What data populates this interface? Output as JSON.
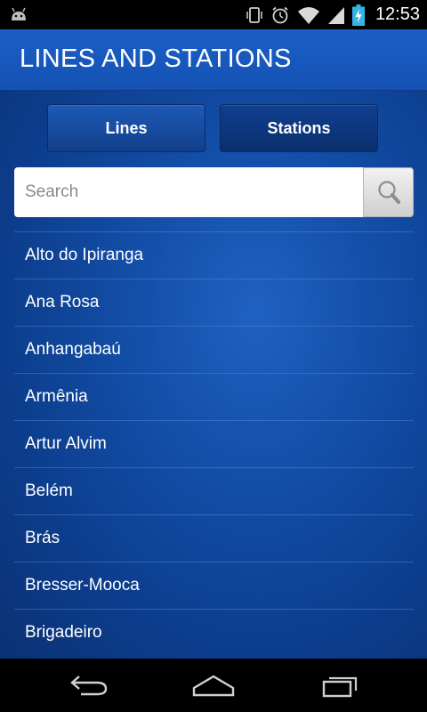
{
  "status_bar": {
    "time": "12:53",
    "icons": [
      "android-notification-icon",
      "vibrate-icon",
      "alarm-icon",
      "wifi-icon",
      "signal-icon",
      "battery-charging-icon"
    ]
  },
  "header": {
    "title": "LINES AND STATIONS"
  },
  "tabs": [
    {
      "label": "Lines"
    },
    {
      "label": "Stations"
    }
  ],
  "search": {
    "placeholder": "Search",
    "value": "",
    "icon": "magnifier-icon"
  },
  "stations": [
    "Alto do Ipiranga",
    "Ana Rosa",
    "Anhangabaú",
    "Armênia",
    "Artur Alvim",
    "Belém",
    "Brás",
    "Bresser-Mooca",
    "Brigadeiro"
  ],
  "navbar": {
    "icons": [
      "back-icon",
      "home-icon",
      "recent-apps-icon"
    ]
  },
  "colors": {
    "header": "#1552b4",
    "background": "#134ea8",
    "text": "#ffffff"
  }
}
